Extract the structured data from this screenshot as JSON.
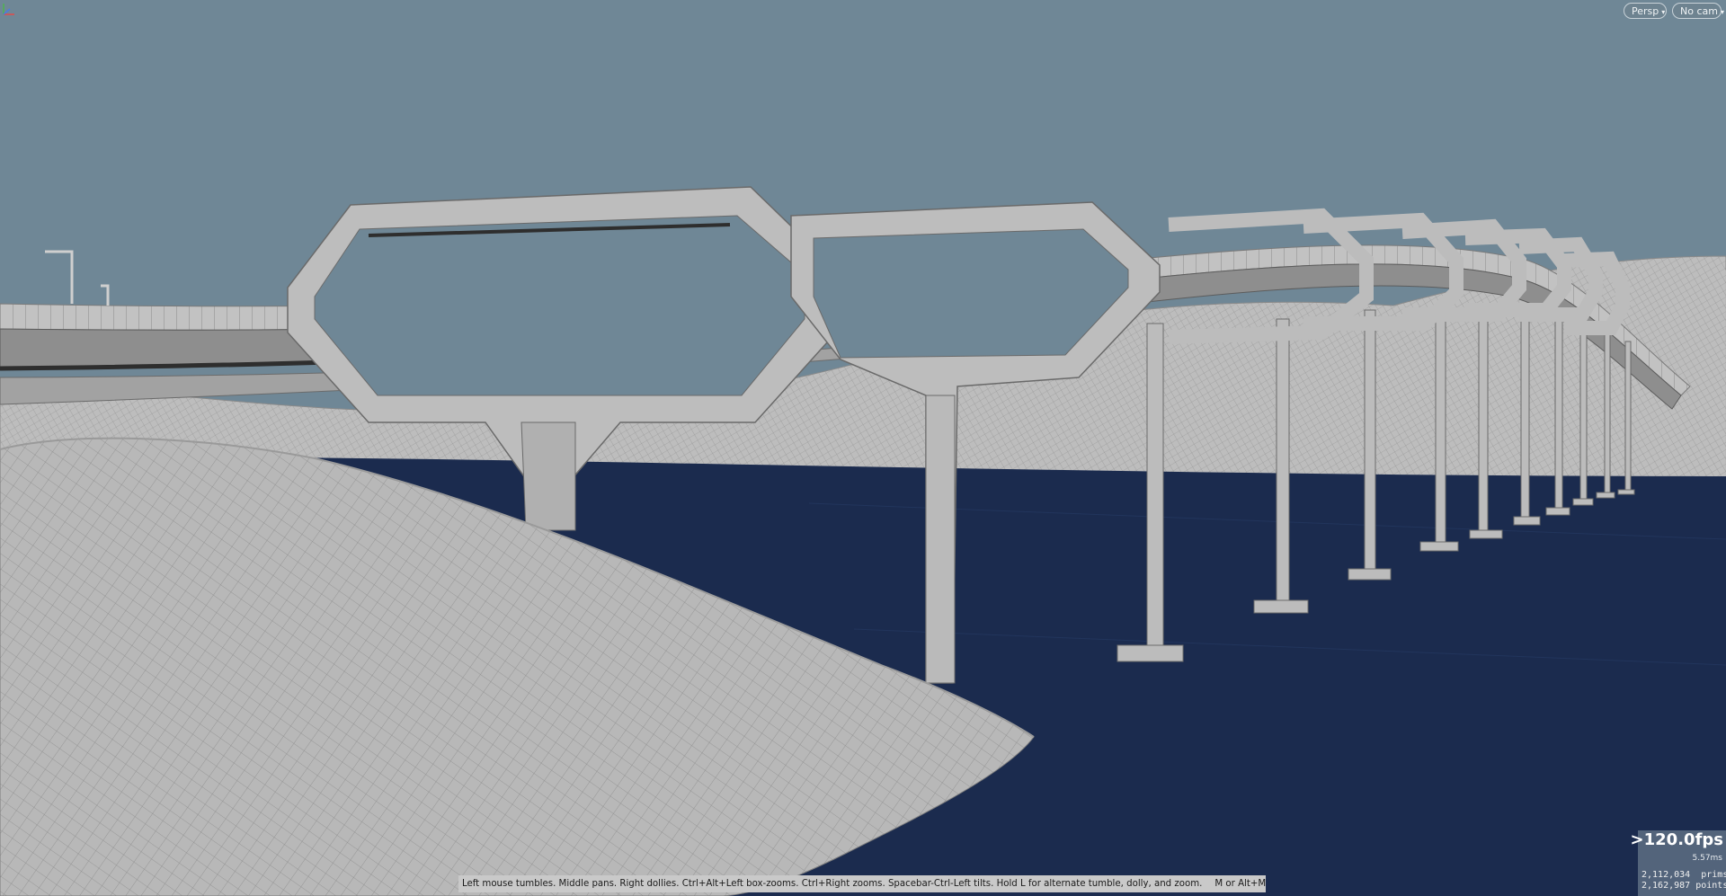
{
  "viewport": {
    "camera_menu": "Persp",
    "camera_select": "No cam"
  },
  "stats": {
    "fps": ">120.0fps",
    "frame_time": "5.57ms",
    "prims_count": "2,112,034",
    "prims_label": "prims",
    "points_count": "2,162,987",
    "points_label": "points"
  },
  "hint": {
    "text": "Left mouse tumbles. Middle pans. Right dollies. Ctrl+Alt+Left box-zooms. Ctrl+Right zooms. Spacebar-Ctrl-Left tilts. Hold L for alternate tumble, dolly, and zoom.",
    "nav_text": "M or Alt+M for First Person Navigation."
  },
  "icons": {
    "caret": "▾",
    "axis": "axis-gizmo-icon"
  },
  "colors": {
    "sky": "#6f8796",
    "water": "#1b2b4e",
    "geometry": "#b9b9b9"
  }
}
